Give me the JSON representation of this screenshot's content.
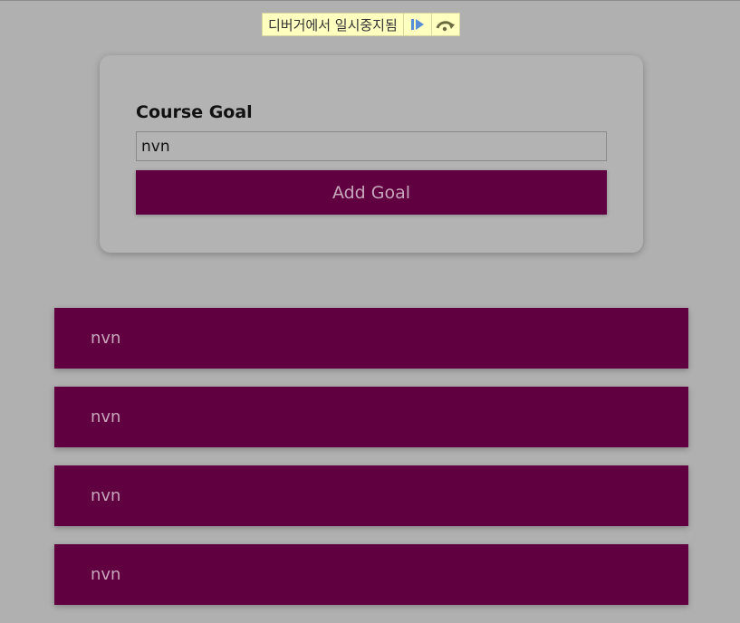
{
  "debugger": {
    "paused_text": "디버거에서 일시중지됨",
    "resume_icon": "resume-icon",
    "step_over_icon": "step-over-icon"
  },
  "form": {
    "label": "Course Goal",
    "input_value": "nvn",
    "button_label": "Add Goal"
  },
  "goals": [
    {
      "text": "nvn"
    },
    {
      "text": "nvn"
    },
    {
      "text": "nvn"
    },
    {
      "text": "nvn"
    }
  ],
  "colors": {
    "background": "#b0b0b0",
    "accent": "#600040",
    "accent_text": "#c8a6bc",
    "debug_bar": "#ffffc0"
  }
}
